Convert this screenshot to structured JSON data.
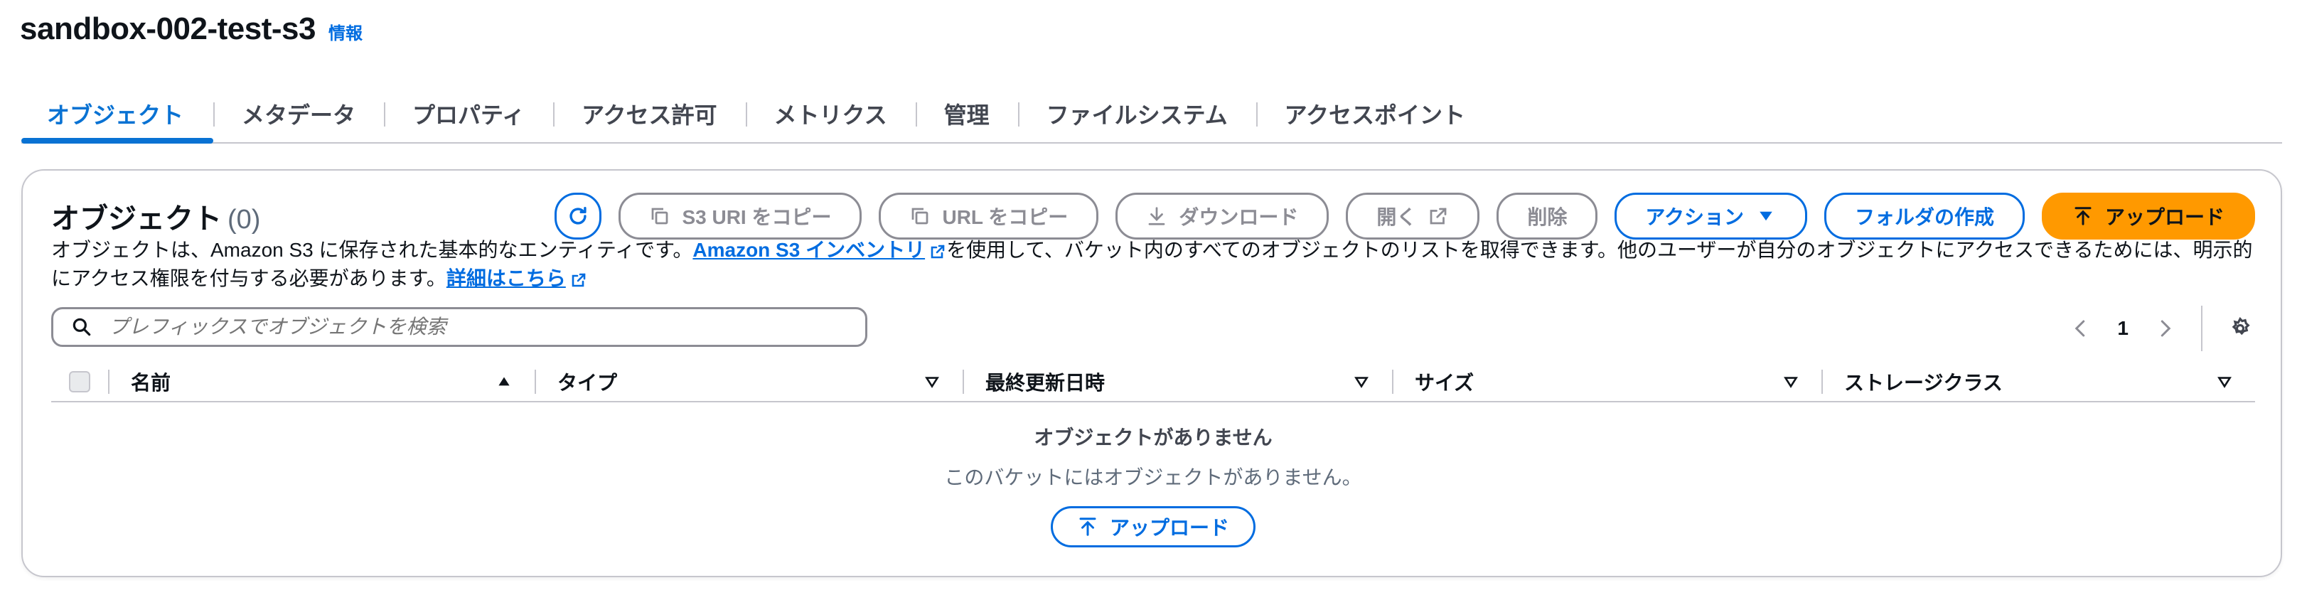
{
  "header": {
    "title": "sandbox-002-test-s3",
    "info_link": "情報"
  },
  "tabs": [
    {
      "label": "オブジェクト"
    },
    {
      "label": "メタデータ"
    },
    {
      "label": "プロパティ"
    },
    {
      "label": "アクセス許可"
    },
    {
      "label": "メトリクス"
    },
    {
      "label": "管理"
    },
    {
      "label": "ファイルシステム"
    },
    {
      "label": "アクセスポイント"
    }
  ],
  "objects": {
    "title": "オブジェクト",
    "count": "(0)",
    "buttons": {
      "copy_s3_uri": "S3 URI をコピー",
      "copy_url": "URL をコピー",
      "download": "ダウンロード",
      "open": "開く",
      "delete": "削除",
      "actions": "アクション",
      "create_folder": "フォルダの作成",
      "upload": "アップロード"
    },
    "description": {
      "part1": "オブジェクトは、Amazon S3 に保存された基本的なエンティティです。",
      "inventory_link": "Amazon S3 インベントリ",
      "part2": "を使用して、バケット内のすべてのオブジェクトのリストを取得できます。他のユーザーが自分のオブジェクトにアクセスできるためには、明示的にアクセス権限を付与する必要があります。",
      "learn_more": "詳細はこちら"
    },
    "search": {
      "placeholder": "プレフィックスでオブジェクトを検索"
    },
    "pagination": {
      "current_page": "1"
    },
    "table": {
      "columns": [
        {
          "label": "名前"
        },
        {
          "label": "タイプ"
        },
        {
          "label": "最終更新日時"
        },
        {
          "label": "サイズ"
        },
        {
          "label": "ストレージクラス"
        }
      ]
    },
    "empty": {
      "title": "オブジェクトがありません",
      "description": "このバケットにはオブジェクトがありません。",
      "upload_button": "アップロード"
    }
  },
  "colors": {
    "primary": "#ff9900",
    "link": "#006ce0",
    "active_tab": "#0972d3"
  },
  "icons": [
    "refresh-icon",
    "copy-icon",
    "download-icon",
    "external-link-icon",
    "caret-down-icon",
    "upload-icon",
    "search-icon",
    "chevron-left-icon",
    "chevron-right-icon",
    "gear-icon",
    "sort-asc-icon",
    "sort-icon"
  ]
}
